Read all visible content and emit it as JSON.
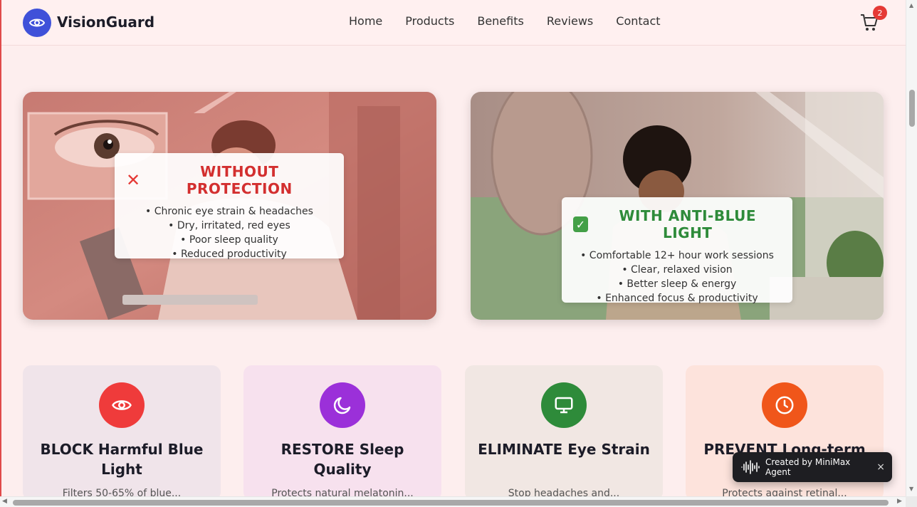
{
  "header": {
    "brand": "VisionGuard",
    "nav": [
      "Home",
      "Products",
      "Benefits",
      "Reviews",
      "Contact"
    ],
    "cart_count": "2"
  },
  "comparison": {
    "without": {
      "title": "WITHOUT PROTECTION",
      "points": [
        "• Chronic eye strain & headaches",
        "• Dry, irritated, red eyes",
        "• Poor sleep quality",
        "• Reduced productivity"
      ]
    },
    "with": {
      "title": "WITH ANTI-BLUE LIGHT",
      "points": [
        "• Comfortable 12+ hour work sessions",
        "• Clear, relaxed vision",
        "• Better sleep & energy",
        "• Enhanced focus & productivity"
      ]
    }
  },
  "features": [
    {
      "title": "BLOCK Harmful Blue Light",
      "desc": "Filters 50-65% of blue...",
      "icon": "eye-icon",
      "color": "#ef3b3b"
    },
    {
      "title": "RESTORE Sleep Quality",
      "desc": "Protects natural melatonin...",
      "icon": "moon-icon",
      "color": "#9b30d9"
    },
    {
      "title": "ELIMINATE Eye Strain",
      "desc": "Stop headaches and...",
      "icon": "monitor-icon",
      "color": "#2e8b3a"
    },
    {
      "title": "PREVENT Long-term",
      "desc": "Protects against retinal...",
      "icon": "clock-icon",
      "color": "#f0561a"
    }
  ],
  "toast": {
    "text": "Created by MiniMax Agent",
    "close": "×"
  }
}
